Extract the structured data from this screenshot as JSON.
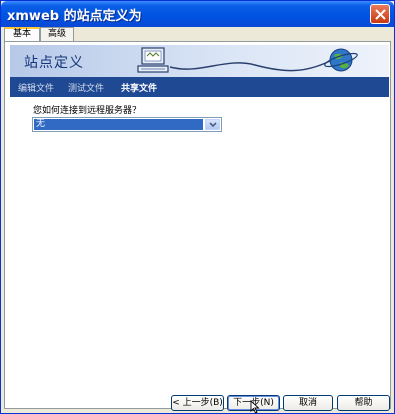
{
  "window": {
    "title": "xmweb 的站点定义为"
  },
  "tabs": [
    {
      "label": "基本"
    },
    {
      "label": "高级"
    }
  ],
  "banner": {
    "title": "站点定义"
  },
  "steps": [
    {
      "label": "编辑文件"
    },
    {
      "label": "测试文件"
    },
    {
      "label": "共享文件"
    }
  ],
  "form": {
    "question": "您如何连接到远程服务器？",
    "connection_select": {
      "value": "无"
    }
  },
  "buttons": {
    "back": "< 上一步(B)",
    "next": "下一步(N) >",
    "cancel": "取消",
    "help": "帮助"
  },
  "colors": {
    "titlebar": "#0053e1",
    "steps_bar": "#1f4993",
    "selection": "#316ac5"
  },
  "icons": [
    "close-icon",
    "computer-icon",
    "globe-icon",
    "dropdown-arrow-icon",
    "mouse-cursor-icon"
  ]
}
